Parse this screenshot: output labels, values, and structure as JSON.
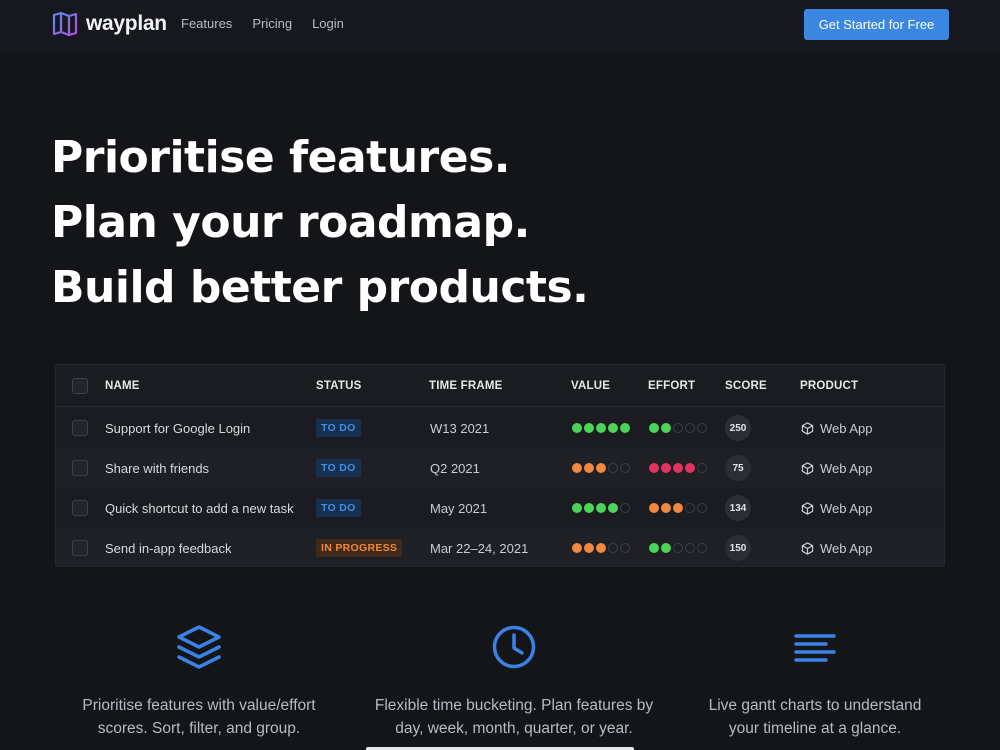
{
  "nav": {
    "logo_text": "wayplan",
    "links": [
      "Features",
      "Pricing",
      "Login"
    ],
    "cta_label": "Get Started for Free"
  },
  "hero": {
    "lines": [
      "Prioritise features.",
      "Plan your roadmap.",
      "Build better products."
    ]
  },
  "table": {
    "headers": [
      "NAME",
      "STATUS",
      "TIME FRAME",
      "VALUE",
      "EFFORT",
      "SCORE",
      "PRODUCT"
    ],
    "rows": [
      {
        "name": "Support for Google Login",
        "status": "TO DO",
        "status_kind": "todo",
        "time_frame": "W13 2021",
        "value": 5,
        "value_color": "#4cd35a",
        "effort": 2,
        "effort_color": "#4cd35a",
        "score": "250",
        "product": "Web App"
      },
      {
        "name": "Share with friends",
        "status": "TO DO",
        "status_kind": "todo",
        "time_frame": "Q2 2021",
        "value": 3,
        "value_color": "#f0883e",
        "effort": 4,
        "effort_color": "#e5335f",
        "score": "75",
        "product": "Web App"
      },
      {
        "name": "Quick shortcut to add a new task",
        "status": "TO DO",
        "status_kind": "todo",
        "time_frame": "May 2021",
        "value": 4,
        "value_color": "#4cd35a",
        "effort": 3,
        "effort_color": "#f0883e",
        "score": "134",
        "product": "Web App"
      },
      {
        "name": "Send in-app feedback",
        "status": "IN PROGRESS",
        "status_kind": "progress",
        "time_frame": "Mar 22–24, 2021",
        "value": 3,
        "value_color": "#f0883e",
        "effort": 2,
        "effort_color": "#4cd35a",
        "score": "150",
        "product": "Web App"
      }
    ],
    "dot_max": 5,
    "status_colors": {
      "todo": {
        "text": "#3d8fe8",
        "bg": "#18304d"
      },
      "progress": {
        "text": "#f0883e",
        "bg": "#3f2a1c"
      }
    }
  },
  "features": [
    {
      "icon": "layers-icon",
      "text_1": "Prioritise features with value/effort",
      "text_2": "scores. Sort, filter, and group."
    },
    {
      "icon": "clock-icon",
      "text_1": "Flexible time bucketing. Plan features by",
      "text_2": "day, week, month, quarter, or year."
    },
    {
      "icon": "gantt-lines-icon",
      "text_1": "Live gantt charts to understand",
      "text_2": "your timeline at a glance."
    }
  ],
  "colors": {
    "accent": "#3a86e0",
    "icon_blue": "#3b82e6",
    "empty_dot": "#3a3e46"
  }
}
